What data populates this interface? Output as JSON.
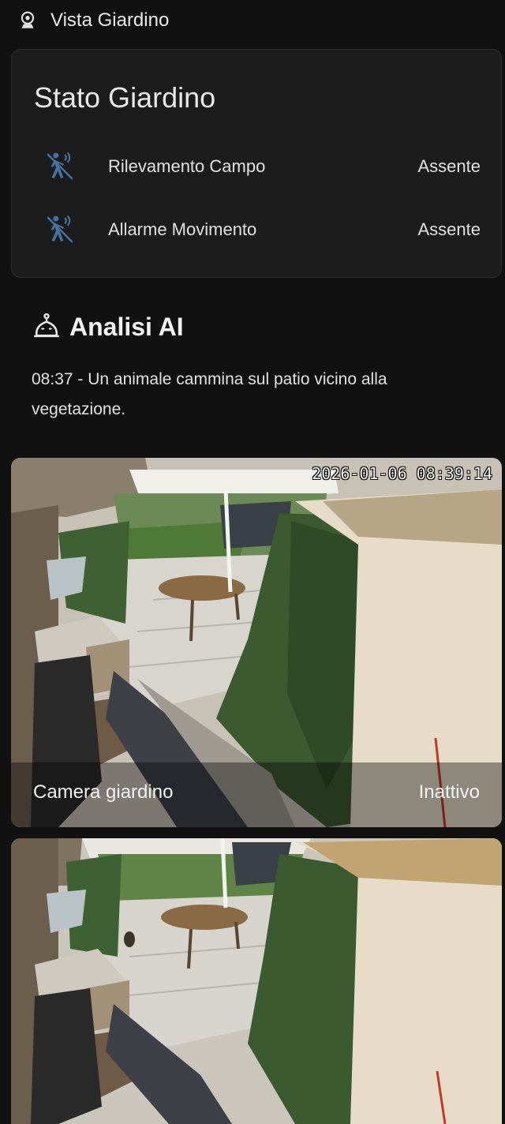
{
  "header": {
    "title": "Vista Giardino",
    "icon": "webcam-icon"
  },
  "status_card": {
    "title": "Stato Giardino",
    "rows": [
      {
        "label": "Rilevamento Campo",
        "value": "Assente",
        "icon": "motion-sensor-icon"
      },
      {
        "label": "Allarme Movimento",
        "value": "Assente",
        "icon": "motion-sensor-icon"
      }
    ]
  },
  "ai_section": {
    "title": "Analisi AI",
    "icon": "robot-icon",
    "description": "08:37 - Un animale cammina sul patio vicino alla vegetazione."
  },
  "cameras": [
    {
      "name": "Camera giardino",
      "state": "Inattivo",
      "timestamp": "2026-01-06 08:39:14"
    },
    {
      "name": "",
      "state": "",
      "timestamp": ""
    }
  ],
  "colors": {
    "background": "#111111",
    "card": "#1c1c1c",
    "icon_blue": "#44739e",
    "text": "#e1e1e1"
  }
}
